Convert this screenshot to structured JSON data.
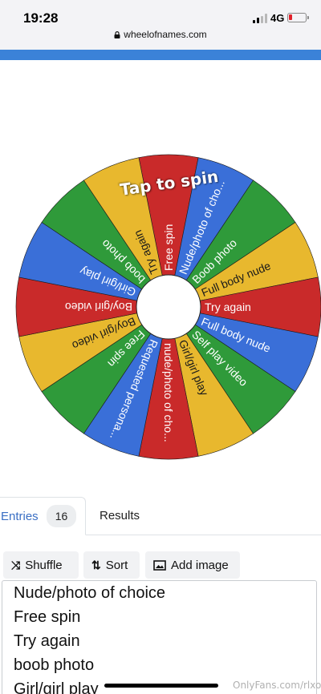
{
  "status": {
    "time": "19:28",
    "network": "4G"
  },
  "browser": {
    "url": "wheelofnames.com"
  },
  "wheel": {
    "tap_label": "Tap to spin",
    "colors": [
      "#c92a2a",
      "#3a6fd8",
      "#2f9a3a",
      "#e8b82e"
    ],
    "slices": [
      "Free spin",
      "Nude/photo of cho...",
      "Boob photo",
      "Full body nude",
      "Try again",
      "Full body nude",
      "Self play video",
      "Girl/girl play",
      "nude/photo of cho...",
      "Requested persona...",
      "Free spin",
      "Boy/girl video",
      "Boy/girl video",
      "Girl/girl play",
      "boob photo",
      "Try again"
    ]
  },
  "tabs": {
    "entries_label": "Entries",
    "entries_count": "16",
    "results_label": "Results"
  },
  "toolbar": {
    "shuffle_label": "Shuffle",
    "sort_label": "Sort",
    "add_image_label": "Add image"
  },
  "entries": [
    "Nude/photo of choice",
    "Free spin",
    "Try again",
    "boob photo",
    "Girl/girl play"
  ],
  "watermark": "OnlyFans.com/rlxox"
}
